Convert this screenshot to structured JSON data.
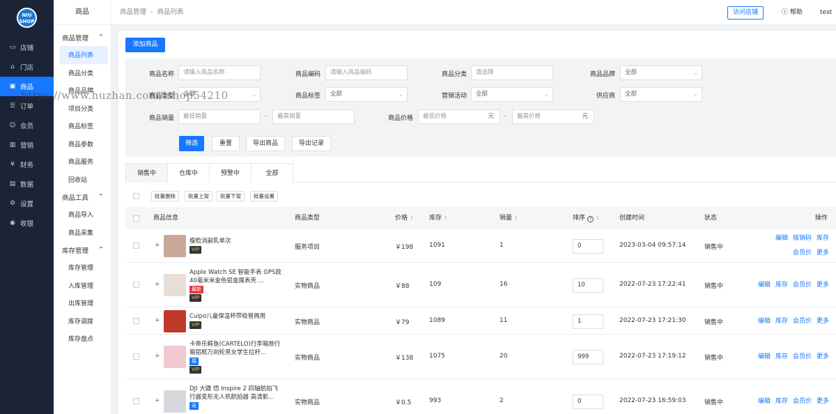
{
  "logo": {
    "line1": "NIU",
    "line2": "SHOP"
  },
  "nav": [
    {
      "label": "店铺",
      "icon": "store-icon",
      "glyph": "▭"
    },
    {
      "label": "门店",
      "icon": "shop-icon",
      "glyph": "⌂"
    },
    {
      "label": "商品",
      "icon": "goods-icon",
      "glyph": "▣",
      "active": true
    },
    {
      "label": "订单",
      "icon": "order-icon",
      "glyph": "☰"
    },
    {
      "label": "会员",
      "icon": "member-icon",
      "glyph": "☺"
    },
    {
      "label": "营销",
      "icon": "marketing-icon",
      "glyph": "▥"
    },
    {
      "label": "财务",
      "icon": "finance-icon",
      "glyph": "¥"
    },
    {
      "label": "数据",
      "icon": "data-icon",
      "glyph": "▤"
    },
    {
      "label": "设置",
      "icon": "settings-icon",
      "glyph": "⚙"
    },
    {
      "label": "收银",
      "icon": "cashier-icon",
      "glyph": "◉"
    }
  ],
  "submenu": {
    "title": "商品",
    "groups": [
      {
        "label": "商品管理",
        "items": [
          "商品列表",
          "商品分类",
          "商品品牌",
          "项目分类",
          "商品标签",
          "商品参数",
          "商品服务",
          "回收站"
        ]
      },
      {
        "label": "商品工具",
        "items": [
          "商品导入",
          "商品采集"
        ]
      },
      {
        "label": "库存管理",
        "items": [
          "库存管理",
          "入库管理",
          "出库管理",
          "库存调拨",
          "库存盘点"
        ]
      }
    ]
  },
  "topbar": {
    "crumb1": "商品管理",
    "sep": "-",
    "crumb2": "商品列表",
    "visit": "访问店铺",
    "help": "帮助",
    "user": "test"
  },
  "add_button": "添加商品",
  "filters": {
    "name_label": "商品名称",
    "name_ph": "请输入商品名称",
    "code_label": "商品编码",
    "code_ph": "请输入商品编码",
    "cat_label": "商品分类",
    "cat_ph": "请选择",
    "brand_label": "商品品牌",
    "brand_val": "全部",
    "type_label": "商品类型",
    "type_val": "全部",
    "tag_label": "商品标签",
    "tag_val": "全部",
    "promo_label": "营销活动",
    "promo_val": "全部",
    "supplier_label": "供应商",
    "supplier_val": "全部",
    "sales_label": "商品销量",
    "sales_min": "最低销量",
    "sales_max": "最高销量",
    "dash": "-",
    "price_label": "商品价格",
    "price_min": "最低价格",
    "price_max": "最高价格",
    "unit": "元",
    "btn_filter": "筛选",
    "btn_reset": "重置",
    "btn_export": "导出商品",
    "btn_records": "导出记录"
  },
  "tabs": [
    "销售中",
    "仓库中",
    "预警中",
    "全部"
  ],
  "batch": [
    "批量删除",
    "批量上架",
    "批量下架",
    "批量设置"
  ],
  "columns": {
    "info": "商品信息",
    "type": "商品类型",
    "price": "价格",
    "stock": "库存",
    "sales": "销量",
    "sort": "排序",
    "created": "创建时间",
    "status": "状态",
    "ops": "操作"
  },
  "rows": [
    {
      "name": "瘦脸消副乳单次",
      "tags": [
        {
          "t": "VIP",
          "c": "vip"
        }
      ],
      "type": "服务项目",
      "price": "￥198",
      "stock": "1091",
      "sales": "1",
      "sort": "0",
      "created": "2023-03-04 09:57:14",
      "status": "销售中",
      "ops1": [
        "编辑",
        "核销码",
        "库存"
      ],
      "ops2": [
        "会员价",
        "更多"
      ],
      "thumb": "#c9a89a"
    },
    {
      "name": "Apple Watch SE 智能手表 GPS款 40毫米米金色铝金属表壳 ...",
      "tags": [
        {
          "t": "最新",
          "c": "new"
        },
        {
          "t": "VIP",
          "c": "vip"
        }
      ],
      "type": "实物商品",
      "price": "￥88",
      "stock": "109",
      "sales": "16",
      "sort": "10",
      "created": "2022-07-23 17:22:41",
      "status": "销售中",
      "ops1": [
        "编辑",
        "库存",
        "会员价",
        "更多"
      ],
      "thumb": "#e8ded6"
    },
    {
      "name": "Cuipo儿童保温杯带吸管两用",
      "tags": [
        {
          "t": "VIP",
          "c": "vip"
        }
      ],
      "type": "实物商品",
      "price": "￥79",
      "stock": "1089",
      "sales": "11",
      "sort": "1",
      "created": "2022-07-23 17:21:30",
      "status": "销售中",
      "ops1": [
        "编辑",
        "库存",
        "会员价",
        "更多"
      ],
      "thumb": "#c0392b"
    },
    {
      "name": "卡帝乐鳄鱼(CARTELO)行李箱旅行箱铝框万向轮男女学生拉杆...",
      "tags": [
        {
          "t": "接",
          "c": "blue"
        },
        {
          "t": "VIP",
          "c": "vip"
        }
      ],
      "type": "实物商品",
      "price": "￥138",
      "stock": "1075",
      "sales": "20",
      "sort": "999",
      "created": "2022-07-23 17:19:12",
      "status": "销售中",
      "ops1": [
        "编辑",
        "库存",
        "会员价",
        "更多"
      ],
      "thumb": "#f2c9cf"
    },
    {
      "name": "DJI 大疆 悟 Inspire 2 四轴航拍飞行器变形无人机航拍器 高清影...",
      "tags": [
        {
          "t": "返",
          "c": "blue"
        }
      ],
      "type": "实物商品",
      "price": "￥0.5",
      "stock": "993",
      "sales": "2",
      "sort": "0",
      "created": "2022-07-23 16:59:03",
      "status": "销售中",
      "ops1": [
        "编辑",
        "库存",
        "会员价",
        "更多"
      ],
      "thumb": "#d5d8dc"
    }
  ],
  "watermark": "https://www.huzhan.com/ishop54210"
}
